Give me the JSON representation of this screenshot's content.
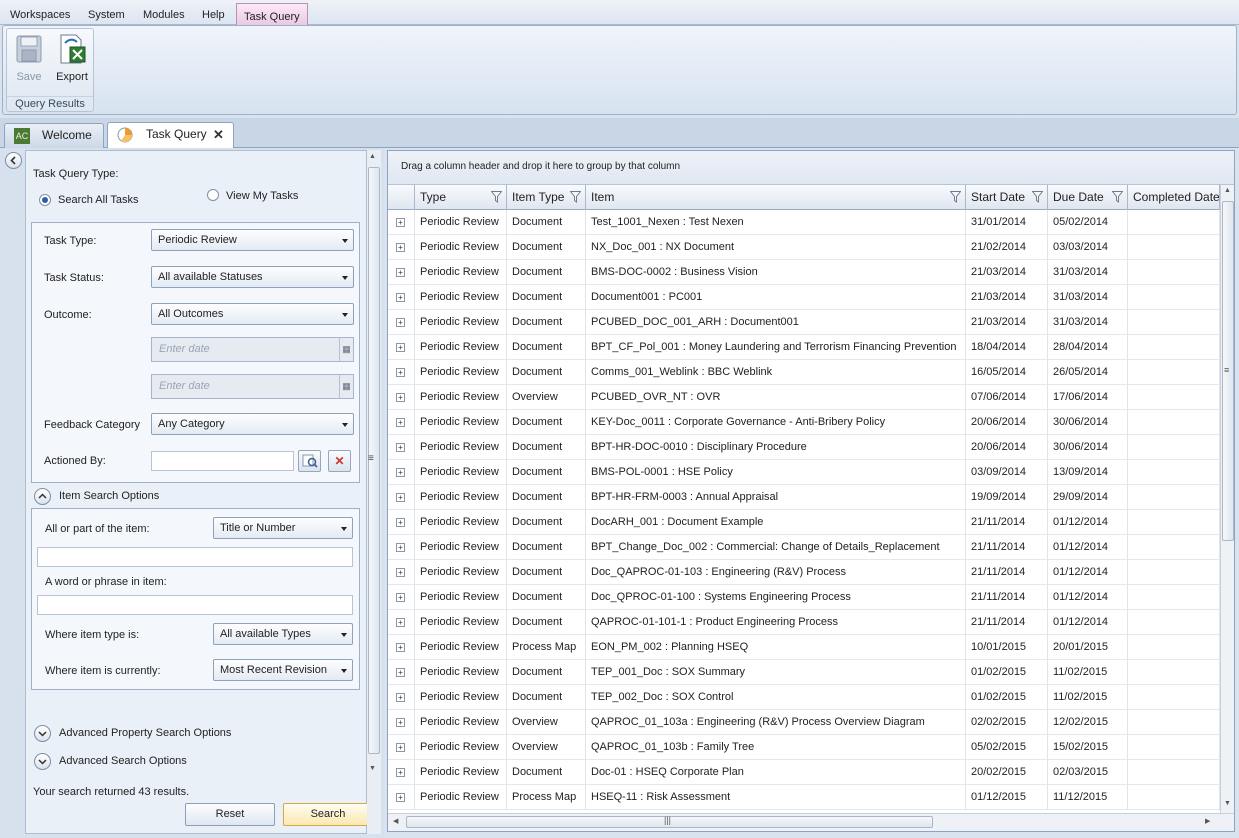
{
  "menu": {
    "items": [
      "Workspaces",
      "System",
      "Modules",
      "Help"
    ],
    "active_tab": "Task Query"
  },
  "ribbon": {
    "save_label": "Save",
    "export_label": "Export",
    "group_label": "Query Results"
  },
  "tabs": {
    "welcome": "Welcome",
    "task_query": "Task Query"
  },
  "query_panel": {
    "type_heading": "Task Query Type:",
    "radio_all": "Search All Tasks",
    "radio_mine": "View My Tasks",
    "task_type_label": "Task Type:",
    "task_type_value": "Periodic Review",
    "task_status_label": "Task Status:",
    "task_status_value": "All available Statuses",
    "outcome_label": "Outcome:",
    "outcome_value": "All Outcomes",
    "date_placeholder": "Enter date",
    "feedback_label": "Feedback Category",
    "feedback_value": "Any Category",
    "actioned_label": "Actioned By:",
    "item_search_title": "Item Search Options",
    "all_or_part_label": "All or part of the item:",
    "all_or_part_value": "Title or Number",
    "phrase_label": "A word or phrase in item:",
    "item_type_label": "Where item type is:",
    "item_type_value": "All available Types",
    "item_current_label": "Where item is currently:",
    "item_current_value": "Most Recent Revision",
    "adv_property": "Advanced Property Search Options",
    "adv_search": "Advanced Search Options",
    "result_text": "Your search returned 43 results.",
    "reset": "Reset",
    "search": "Search"
  },
  "grid": {
    "group_hint": "Drag a column header and drop it here to group by that column",
    "columns": [
      "Type",
      "Item Type",
      "Item",
      "Start Date",
      "Due Date",
      "Completed Date"
    ],
    "rows": [
      [
        "Periodic Review",
        "Document",
        "Test_1001_Nexen : Test Nexen",
        "31/01/2014",
        "05/02/2014",
        ""
      ],
      [
        "Periodic Review",
        "Document",
        "NX_Doc_001 : NX Document",
        "21/02/2014",
        "03/03/2014",
        ""
      ],
      [
        "Periodic Review",
        "Document",
        "BMS-DOC-0002 : Business Vision",
        "21/03/2014",
        "31/03/2014",
        ""
      ],
      [
        "Periodic Review",
        "Document",
        "Document001 : PC001",
        "21/03/2014",
        "31/03/2014",
        ""
      ],
      [
        "Periodic Review",
        "Document",
        "PCUBED_DOC_001_ARH : Document001",
        "21/03/2014",
        "31/03/2014",
        ""
      ],
      [
        "Periodic Review",
        "Document",
        "BPT_CF_Pol_001 : Money Laundering and Terrorism Financing Prevention",
        "18/04/2014",
        "28/04/2014",
        ""
      ],
      [
        "Periodic Review",
        "Document",
        "Comms_001_Weblink : BBC Weblink",
        "16/05/2014",
        "26/05/2014",
        ""
      ],
      [
        "Periodic Review",
        "Overview",
        "PCUBED_OVR_NT : OVR",
        "07/06/2014",
        "17/06/2014",
        ""
      ],
      [
        "Periodic Review",
        "Document",
        "KEY-Doc_0011 : Corporate Governance - Anti-Bribery Policy",
        "20/06/2014",
        "30/06/2014",
        ""
      ],
      [
        "Periodic Review",
        "Document",
        "BPT-HR-DOC-0010 : Disciplinary Procedure",
        "20/06/2014",
        "30/06/2014",
        ""
      ],
      [
        "Periodic Review",
        "Document",
        "BMS-POL-0001 : HSE Policy",
        "03/09/2014",
        "13/09/2014",
        ""
      ],
      [
        "Periodic Review",
        "Document",
        "BPT-HR-FRM-0003 : Annual Appraisal",
        "19/09/2014",
        "29/09/2014",
        ""
      ],
      [
        "Periodic Review",
        "Document",
        "DocARH_001 : Document Example",
        "21/11/2014",
        "01/12/2014",
        ""
      ],
      [
        "Periodic Review",
        "Document",
        "BPT_Change_Doc_002 : Commercial: Change of Details_Replacement",
        "21/11/2014",
        "01/12/2014",
        ""
      ],
      [
        "Periodic Review",
        "Document",
        "Doc_QAPROC-01-103 : Engineering (R&V) Process",
        "21/11/2014",
        "01/12/2014",
        ""
      ],
      [
        "Periodic Review",
        "Document",
        "Doc_QPROC-01-100 : Systems Engineering Process",
        "21/11/2014",
        "01/12/2014",
        ""
      ],
      [
        "Periodic Review",
        "Document",
        "QAPROC-01-101-1 : Product Engineering Process",
        "21/11/2014",
        "01/12/2014",
        ""
      ],
      [
        "Periodic Review",
        "Process Map",
        "EON_PM_002 : Planning HSEQ",
        "10/01/2015",
        "20/01/2015",
        ""
      ],
      [
        "Periodic Review",
        "Document",
        "TEP_001_Doc : SOX Summary",
        "01/02/2015",
        "11/02/2015",
        ""
      ],
      [
        "Periodic Review",
        "Document",
        "TEP_002_Doc : SOX Control",
        "01/02/2015",
        "11/02/2015",
        ""
      ],
      [
        "Periodic Review",
        "Overview",
        "QAPROC_01_103a : Engineering (R&V) Process Overview Diagram",
        "02/02/2015",
        "12/02/2015",
        ""
      ],
      [
        "Periodic Review",
        "Overview",
        "QAPROC_01_103b : Family Tree",
        "05/02/2015",
        "15/02/2015",
        ""
      ],
      [
        "Periodic Review",
        "Document",
        "Doc-01 : HSEQ Corporate Plan",
        "20/02/2015",
        "02/03/2015",
        ""
      ],
      [
        "Periodic Review",
        "Process Map",
        "HSEQ-11 : Risk Assessment",
        "01/12/2015",
        "11/12/2015",
        ""
      ]
    ]
  }
}
